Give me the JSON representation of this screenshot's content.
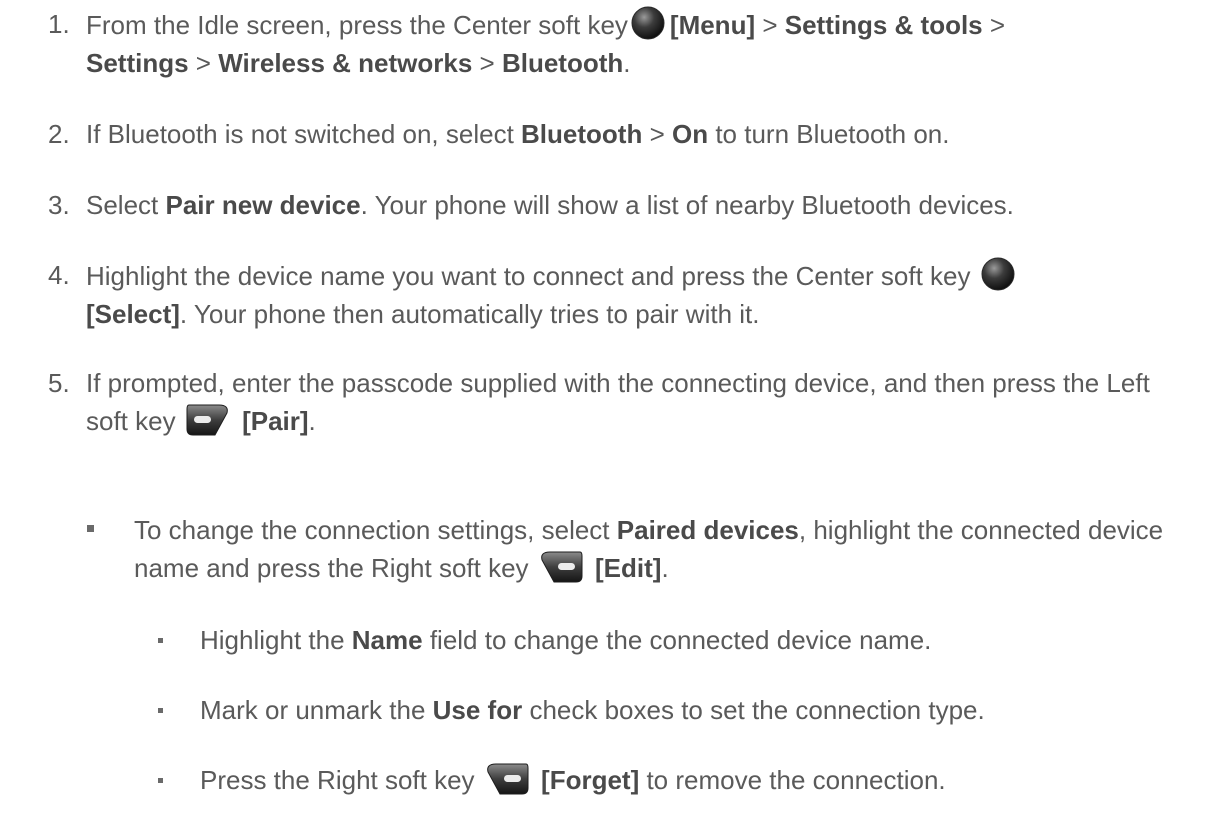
{
  "steps": [
    {
      "number": "1.",
      "t1": "From the Idle screen, press the Center soft key",
      "b1": "[Menu]",
      "t2": " > ",
      "b2": "Settings & tools",
      "t3": " > ",
      "b3": "Settings",
      "t4": " > ",
      "b4": "Wireless & networks",
      "t5": " > ",
      "b5": "Bluetooth",
      "t6": "."
    },
    {
      "number": "2.",
      "t1": "If Bluetooth is not switched on, select ",
      "b1": "Bluetooth",
      "t2": " > ",
      "b2": "On",
      "t3": " to turn Bluetooth on."
    },
    {
      "number": "3.",
      "t1": "Select ",
      "b1": "Pair new device",
      "t2": ". Your phone will show a list of nearby Bluetooth devices."
    },
    {
      "number": "4.",
      "t1": "Highlight the device name you want to connect and press the Center soft key",
      "b1": "[Select]",
      "t2": ". Your phone then automatically tries to pair with it."
    },
    {
      "number": "5.",
      "t1": "If prompted, enter the passcode supplied with the connecting device, and then press the Left soft key",
      "b1": "[Pair]",
      "t2": "."
    }
  ],
  "bullet": {
    "t1": "To change the connection settings, select ",
    "b1": "Paired devices",
    "t2": ", highlight the connected device name and press the Right soft key",
    "b2": "[Edit]",
    "t3": "."
  },
  "subbullets": [
    {
      "t1": "Highlight the ",
      "b1": "Name",
      "t2": " field to change the connected device name."
    },
    {
      "t1": "Mark or unmark the ",
      "b1": "Use for",
      "t2": " check boxes to set the connection type."
    },
    {
      "t1": "Press the Right soft key",
      "b1": "[Forget]",
      "t2": " to remove the connection."
    }
  ],
  "icons": {
    "center_key": "center-soft-key-icon",
    "left_key": "left-soft-key-icon",
    "right_key": "right-soft-key-icon"
  },
  "colors": {
    "text": "#5a5a5a",
    "bold": "#4a4a4a"
  }
}
